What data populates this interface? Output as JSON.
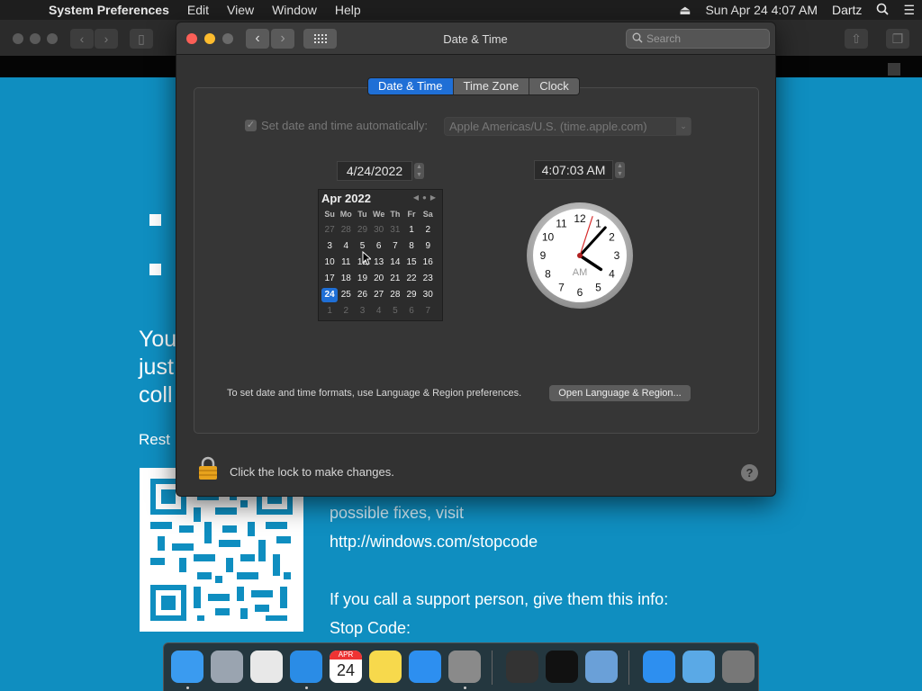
{
  "menubar": {
    "app_name": "System Preferences",
    "menus": [
      "Edit",
      "View",
      "Window",
      "Help"
    ],
    "clock": "Sun Apr 24  4:07 AM",
    "user": "Dartz"
  },
  "background": {
    "bsod_partial_lines": [
      "You",
      "just",
      "coll"
    ],
    "restart_text": "Rest",
    "fixes_text": "possible fixes, visit",
    "url": "http://windows.com/stopcode",
    "support_text": "If you call a support person, give them this info:",
    "stop_code_label": "Stop Code:"
  },
  "window": {
    "title": "Date & Time",
    "search_placeholder": "Search",
    "tabs": [
      {
        "label": "Date & Time",
        "active": true
      },
      {
        "label": "Time Zone",
        "active": false
      },
      {
        "label": "Clock",
        "active": false
      }
    ],
    "auto_label": "Set date and time automatically:",
    "auto_checked": true,
    "time_server": "Apple Americas/U.S. (time.apple.com)",
    "date_value": "4/24/2022",
    "time_value": "4:07:03 AM",
    "calendar": {
      "month_label": "Apr 2022",
      "weekdays": [
        "Su",
        "Mo",
        "Tu",
        "We",
        "Th",
        "Fr",
        "Sa"
      ],
      "weeks": [
        [
          "27",
          "28",
          "29",
          "30",
          "31",
          "1",
          "2"
        ],
        [
          "3",
          "4",
          "5",
          "6",
          "7",
          "8",
          "9"
        ],
        [
          "10",
          "11",
          "12",
          "13",
          "14",
          "15",
          "16"
        ],
        [
          "17",
          "18",
          "19",
          "20",
          "21",
          "22",
          "23"
        ],
        [
          "24",
          "25",
          "26",
          "27",
          "28",
          "29",
          "30"
        ],
        [
          "1",
          "2",
          "3",
          "4",
          "5",
          "6",
          "7"
        ]
      ],
      "selected_day": "24"
    },
    "clock": {
      "ampm": "AM",
      "hour": 4,
      "minute": 7,
      "second": 3,
      "numerals": [
        "12",
        "1",
        "2",
        "3",
        "4",
        "5",
        "6",
        "7",
        "8",
        "9",
        "10",
        "11"
      ]
    },
    "formats_note": "To set date and time formats, use Language & Region preferences.",
    "open_region_button": "Open Language & Region...",
    "lock_text": "Click the lock to make changes.",
    "help_label": "?"
  },
  "dock": {
    "apps": [
      {
        "name": "finder-icon",
        "color": "#3a9bf0",
        "running": true
      },
      {
        "name": "launchpad-icon",
        "color": "#9aa4b0",
        "running": false
      },
      {
        "name": "chrome-icon",
        "color": "#e8e8e8",
        "running": false
      },
      {
        "name": "safari-icon",
        "color": "#2a8ce6",
        "running": true
      },
      {
        "name": "calendar-icon",
        "color": "#ffffff",
        "running": false
      },
      {
        "name": "notes-icon",
        "color": "#f7d94c",
        "running": false
      },
      {
        "name": "app-store-icon",
        "color": "#2d8ff0",
        "running": false
      },
      {
        "name": "system-preferences-icon",
        "color": "#8a8a8a",
        "running": true
      },
      {
        "name": "network-utility-icon",
        "color": "#333333",
        "running": false
      },
      {
        "name": "terminal-icon",
        "color": "#111111",
        "running": false
      },
      {
        "name": "preview-icon",
        "color": "#6aa0d8",
        "running": false
      },
      {
        "name": "app-store-downloads-icon",
        "color": "#2d8ff0",
        "running": false
      },
      {
        "name": "downloads-folder-icon",
        "color": "#5aa9e6",
        "running": false
      },
      {
        "name": "trash-icon",
        "color": "#777777",
        "running": false
      }
    ],
    "calendar_month": "APR",
    "calendar_day": "24"
  }
}
